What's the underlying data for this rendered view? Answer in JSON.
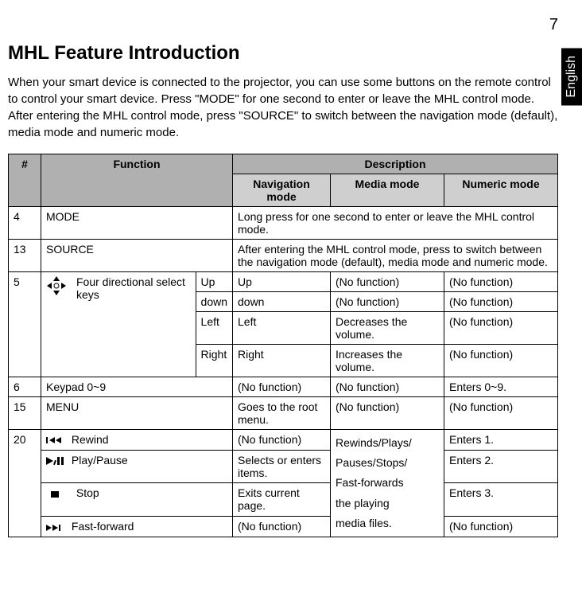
{
  "page_number": "7",
  "lang_tab": "English",
  "heading": "MHL Feature Introduction",
  "intro_text": "When your smart device is connected to the projector, you can use some buttons on the remote control to control your smart device. Press \"MODE\" for one second to enter or leave the MHL control mode. After entering the MHL control mode, press \"SOURCE\" to switch between the navigation mode (default), media mode and numeric mode.",
  "table": {
    "header_num": "#",
    "header_function": "Function",
    "header_description": "Description",
    "sub_nav": "Navigation mode",
    "sub_media": "Media mode",
    "sub_numeric": "Numeric mode",
    "row_mode_num": "4",
    "row_mode_func": "MODE",
    "row_mode_desc": "Long press for one second to enter or leave the MHL control mode.",
    "row_source_num": "13",
    "row_source_func": "SOURCE",
    "row_source_desc": "After entering the MHL control mode, press to switch between the navigation mode (default), media mode and numeric mode.",
    "row_dir_num": "5",
    "row_dir_func": "Four directional select keys",
    "row_dir_up": "Up",
    "row_dir_up_nav": "Up",
    "row_dir_up_media": "(No function)",
    "row_dir_up_num": "(No function)",
    "row_dir_down": "down",
    "row_dir_down_nav": "down",
    "row_dir_down_media": "(No function)",
    "row_dir_down_num": "(No function)",
    "row_dir_left": "Left",
    "row_dir_left_nav": "Left",
    "row_dir_left_media": "Decreases the volume.",
    "row_dir_left_num": "(No function)",
    "row_dir_right": "Right",
    "row_dir_right_nav": "Right",
    "row_dir_right_media": "Increases the volume.",
    "row_dir_right_num": "(No function)",
    "row_keypad_num": "6",
    "row_keypad_func": "Keypad 0~9",
    "row_keypad_nav": "(No function)",
    "row_keypad_media": "(No function)",
    "row_keypad_nummode": "Enters 0~9.",
    "row_menu_num": "15",
    "row_menu_func": "MENU",
    "row_menu_nav": "Goes to the root menu.",
    "row_menu_media": "(No function)",
    "row_menu_nummode": "(No function)",
    "row_transport_num": "20",
    "row_rewind_label": "Rewind",
    "row_rewind_nav": "(No function)",
    "row_transport_media": "Rewinds/Plays/\nPauses/Stops/\nFast-forwards\nthe playing\nmedia files.",
    "row_rewind_num": "Enters 1.",
    "row_play_label": "Play/Pause",
    "row_play_nav": "Selects or enters items.",
    "row_play_num": "Enters 2.",
    "row_stop_label": "Stop",
    "row_stop_nav": "Exits current page.",
    "row_stop_num": "Enters 3.",
    "row_ff_label": "Fast-forward",
    "row_ff_nav": "(No function)",
    "row_ff_num": "(No function)"
  }
}
